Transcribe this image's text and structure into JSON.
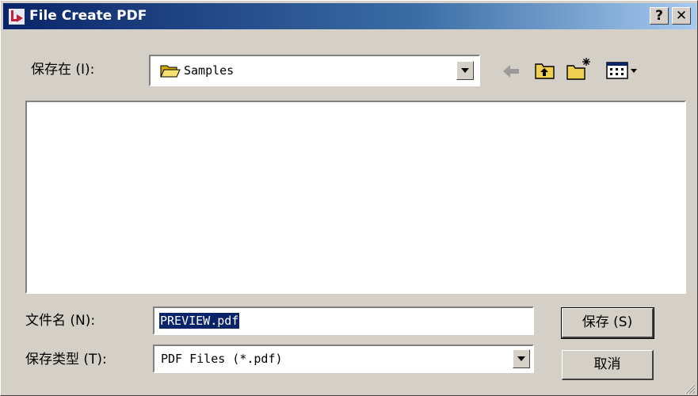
{
  "window": {
    "title": "File Create PDF",
    "help_label": "?",
    "close_label": "✕"
  },
  "save_in": {
    "label": "保存在 (I):",
    "folder": "Samples"
  },
  "filename": {
    "label": "文件名 (N):",
    "value": "PREVIEW.pdf"
  },
  "filetype": {
    "label": "保存类型 (T):",
    "value": "PDF Files (*.pdf)"
  },
  "buttons": {
    "save": "保存 (S)",
    "cancel": "取消"
  }
}
